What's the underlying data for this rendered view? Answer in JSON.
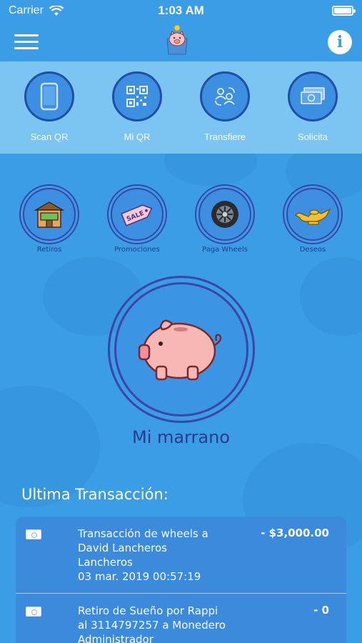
{
  "status_bar": {
    "carrier": "Carrier",
    "time": "1:03 AM"
  },
  "header": {
    "info_label": "i"
  },
  "actions": [
    {
      "label": "Scan QR",
      "icon": "phone-icon"
    },
    {
      "label": "Mi QR",
      "icon": "qr-code-icon"
    },
    {
      "label": "Transfiere",
      "icon": "transfer-users-icon"
    },
    {
      "label": "Solicita",
      "icon": "cash-icon"
    }
  ],
  "tiles": [
    {
      "label": "Retiros",
      "icon": "store-icon"
    },
    {
      "label": "Promociones",
      "icon": "sale-tag-icon"
    },
    {
      "label": "Paga Wheels",
      "icon": "wheel-icon"
    },
    {
      "label": "Deseos",
      "icon": "magic-lamp-icon"
    }
  ],
  "piggy": {
    "title": "Mi marrano"
  },
  "transactions": {
    "heading": "Ultima Transacción:",
    "items": [
      {
        "line1": "Transacción de wheels a",
        "line2": "David Lancheros",
        "line3": "Lancheros",
        "line4": "03 mar. 2019 00:57:19",
        "amount": "- $3,000.00"
      },
      {
        "line1": "Retiro de Sueño por Rappi",
        "line2": "al 3114797257 a Monedero",
        "line3": "Administrador",
        "line4": "",
        "amount": "- 0"
      }
    ]
  },
  "colors": {
    "background": "#3a9de6",
    "panel": "#7cc4f1",
    "circle_fill": "#3d8fe2",
    "ring": "#3a46a8",
    "title": "#2b3a8a"
  }
}
